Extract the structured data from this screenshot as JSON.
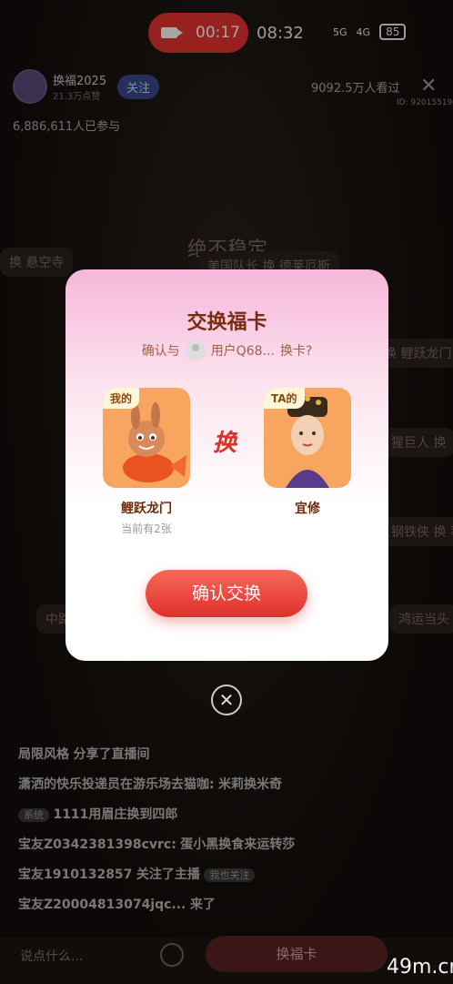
{
  "status_bar": {
    "recording_time": "00:17",
    "clock": "08:32",
    "net1": "5G",
    "net2": "4G",
    "battery": "85"
  },
  "stream": {
    "host_name": "换福2025",
    "host_likes": "21.3万点赞",
    "follow_label": "关注",
    "viewers": "9092.5万人看过",
    "room_id": "ID: 92015519",
    "participants": "6,886,611人已参与"
  },
  "background_cards": [
    "换  悬空寺",
    "绝不稳定",
    "美国队长 换 德莱厄斯",
    "换 鲤跃龙门",
    "猩巨人 换",
    "钢铁侠 换 事",
    "中路",
    "鸿运当头"
  ],
  "modal": {
    "title": "交换福卡",
    "confirm_prefix": "确认与",
    "user": "用户Q68...",
    "confirm_suffix": "换卡?",
    "swap_char": "换",
    "my_card": {
      "tag": "我的",
      "name": "鲤跃龙门",
      "count": "当前有2张"
    },
    "their_card": {
      "tag": "TA的",
      "name": "宜修"
    },
    "confirm_button": "确认交换"
  },
  "chat": [
    {
      "user": "局限风格",
      "msg": "分享了直播间"
    },
    {
      "user": "潇洒的快乐投递员在游乐场去猫咖:",
      "msg": "米莉换米奇"
    },
    {
      "tag": "系统",
      "msg": "1111用眉庄换到四郎"
    },
    {
      "user": "宝友Z0342381398cvrc:",
      "msg": "蛋小黑换食来运转莎"
    },
    {
      "user": "宝友1910132857",
      "msg": "关注了主播",
      "tag": "我也关注"
    },
    {
      "user": "宝友Z20004813074jqc...",
      "msg": "来了"
    }
  ],
  "bottom": {
    "say_placeholder": "说点什么...",
    "swap_label": "换福卡"
  },
  "watermark": "49m.cn"
}
